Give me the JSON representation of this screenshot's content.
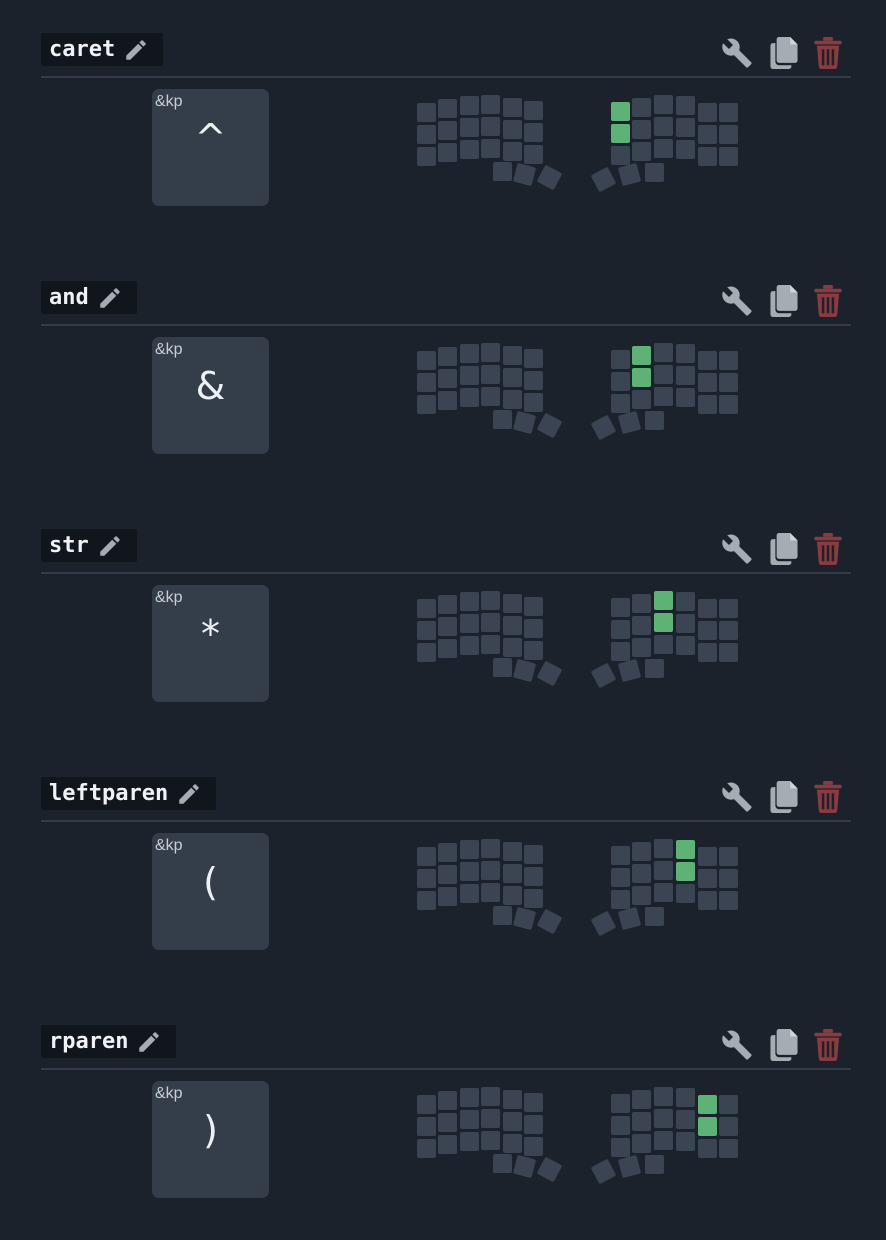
{
  "colors": {
    "background": "#1b222b",
    "key_inactive": "#3a4452",
    "key_active": "#5fb275",
    "trash": "#8b3a40",
    "icon": "#a6acb3"
  },
  "icons": {
    "edit": "pencil-icon",
    "configure": "wrench-icon",
    "duplicate": "copy-icon",
    "delete": "trash-icon"
  },
  "combos": [
    {
      "name": "caret",
      "binding_label": "&kp",
      "binding_key": "^",
      "active_keys": [
        "r1",
        "r2"
      ]
    },
    {
      "name": "and",
      "binding_label": "&kp",
      "binding_key": "&",
      "active_keys": [
        "r3",
        "r4"
      ]
    },
    {
      "name": "str",
      "binding_label": "&kp",
      "binding_key": "*",
      "active_keys": [
        "r5",
        "r6"
      ]
    },
    {
      "name": "leftparen",
      "binding_label": "&kp",
      "binding_key": "(",
      "active_keys": [
        "r7",
        "r8"
      ]
    },
    {
      "name": "rparen",
      "binding_label": "&kp",
      "binding_key": ")",
      "active_keys": [
        "r9",
        "r10"
      ]
    }
  ]
}
